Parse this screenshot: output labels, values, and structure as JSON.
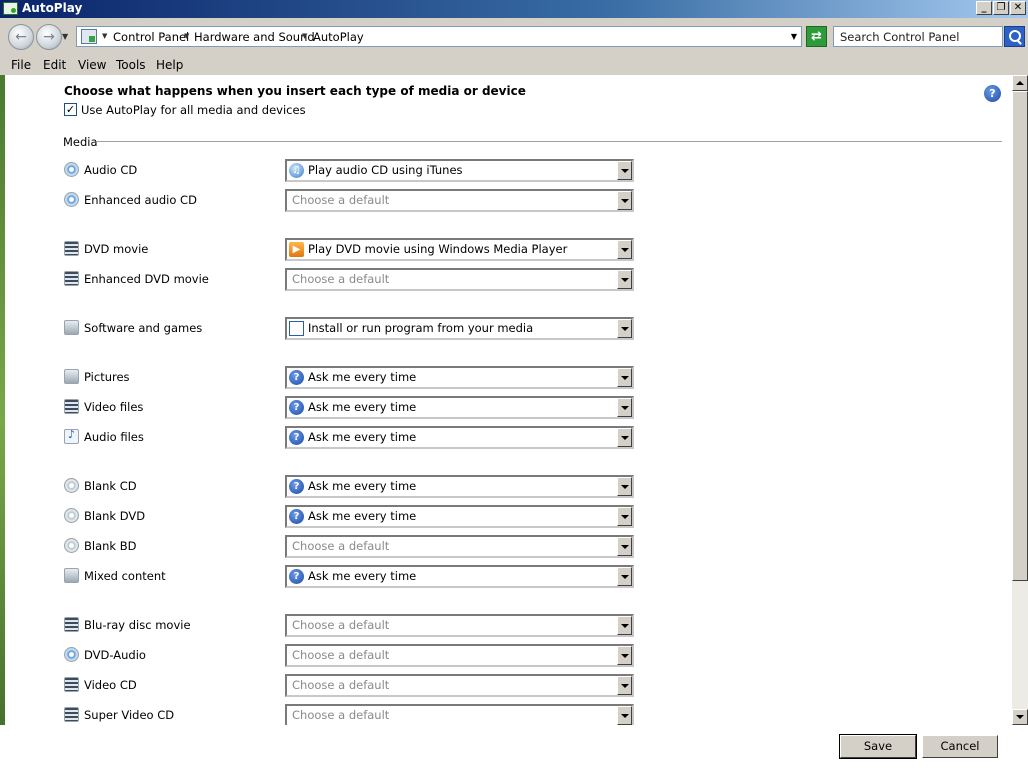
{
  "window": {
    "title": "AutoPlay"
  },
  "window_controls": {
    "minimize": "_",
    "maximize": "❐",
    "close": "✕"
  },
  "address": {
    "breadcrumbs": [
      "Control Panel",
      "Hardware and Sound",
      "AutoPlay"
    ],
    "search_placeholder": "Search Control Panel"
  },
  "menu": [
    "File",
    "Edit",
    "View",
    "Tools",
    "Help"
  ],
  "page": {
    "heading": "Choose what happens when you insert each type of media or device",
    "use_autoplay_label": "Use AutoPlay for all media and devices",
    "use_autoplay_checked": true,
    "section_title": "Media",
    "help": "?"
  },
  "rows": [
    {
      "label": "Audio CD",
      "icon": "cd-icon",
      "value": "Play audio CD using iTunes",
      "value_icon": "itunes-icon"
    },
    {
      "label": "Enhanced audio CD",
      "icon": "cd-icon",
      "value": "Choose a default",
      "value_icon": ""
    },
    {
      "label": "DVD movie",
      "icon": "dvd-icon",
      "value": "Play DVD movie using Windows Media Player",
      "value_icon": "media-player-icon"
    },
    {
      "label": "Enhanced DVD movie",
      "icon": "dvd-icon",
      "value": "Choose a default",
      "value_icon": ""
    },
    {
      "label": "Software and games",
      "icon": "software-icon",
      "value": "Install or run program from your media",
      "value_icon": "program-window-icon"
    },
    {
      "label": "Pictures",
      "icon": "pictures-icon",
      "value": "Ask me every time",
      "value_icon": "question-icon"
    },
    {
      "label": "Video files",
      "icon": "video-icon",
      "value": "Ask me every time",
      "value_icon": "question-icon"
    },
    {
      "label": "Audio files",
      "icon": "audio-file-icon",
      "value": "Ask me every time",
      "value_icon": "question-icon"
    },
    {
      "label": "Blank CD",
      "icon": "disc-icon",
      "value": "Ask me every time",
      "value_icon": "question-icon"
    },
    {
      "label": "Blank DVD",
      "icon": "disc-icon",
      "value": "Ask me every time",
      "value_icon": "question-icon"
    },
    {
      "label": "Blank BD",
      "icon": "disc-icon",
      "value": "Choose a default",
      "value_icon": ""
    },
    {
      "label": "Mixed content",
      "icon": "mixed-content-icon",
      "value": "Ask me every time",
      "value_icon": "question-icon"
    },
    {
      "label": "Blu-ray disc movie",
      "icon": "dvd-icon",
      "value": "Choose a default",
      "value_icon": ""
    },
    {
      "label": "DVD-Audio",
      "icon": "cd-icon",
      "value": "Choose a default",
      "value_icon": ""
    },
    {
      "label": "Video CD",
      "icon": "dvd-icon",
      "value": "Choose a default",
      "value_icon": ""
    },
    {
      "label": "Super Video CD",
      "icon": "dvd-icon",
      "value": "Choose a default",
      "value_icon": ""
    }
  ],
  "footer": {
    "save": "Save",
    "cancel": "Cancel"
  }
}
